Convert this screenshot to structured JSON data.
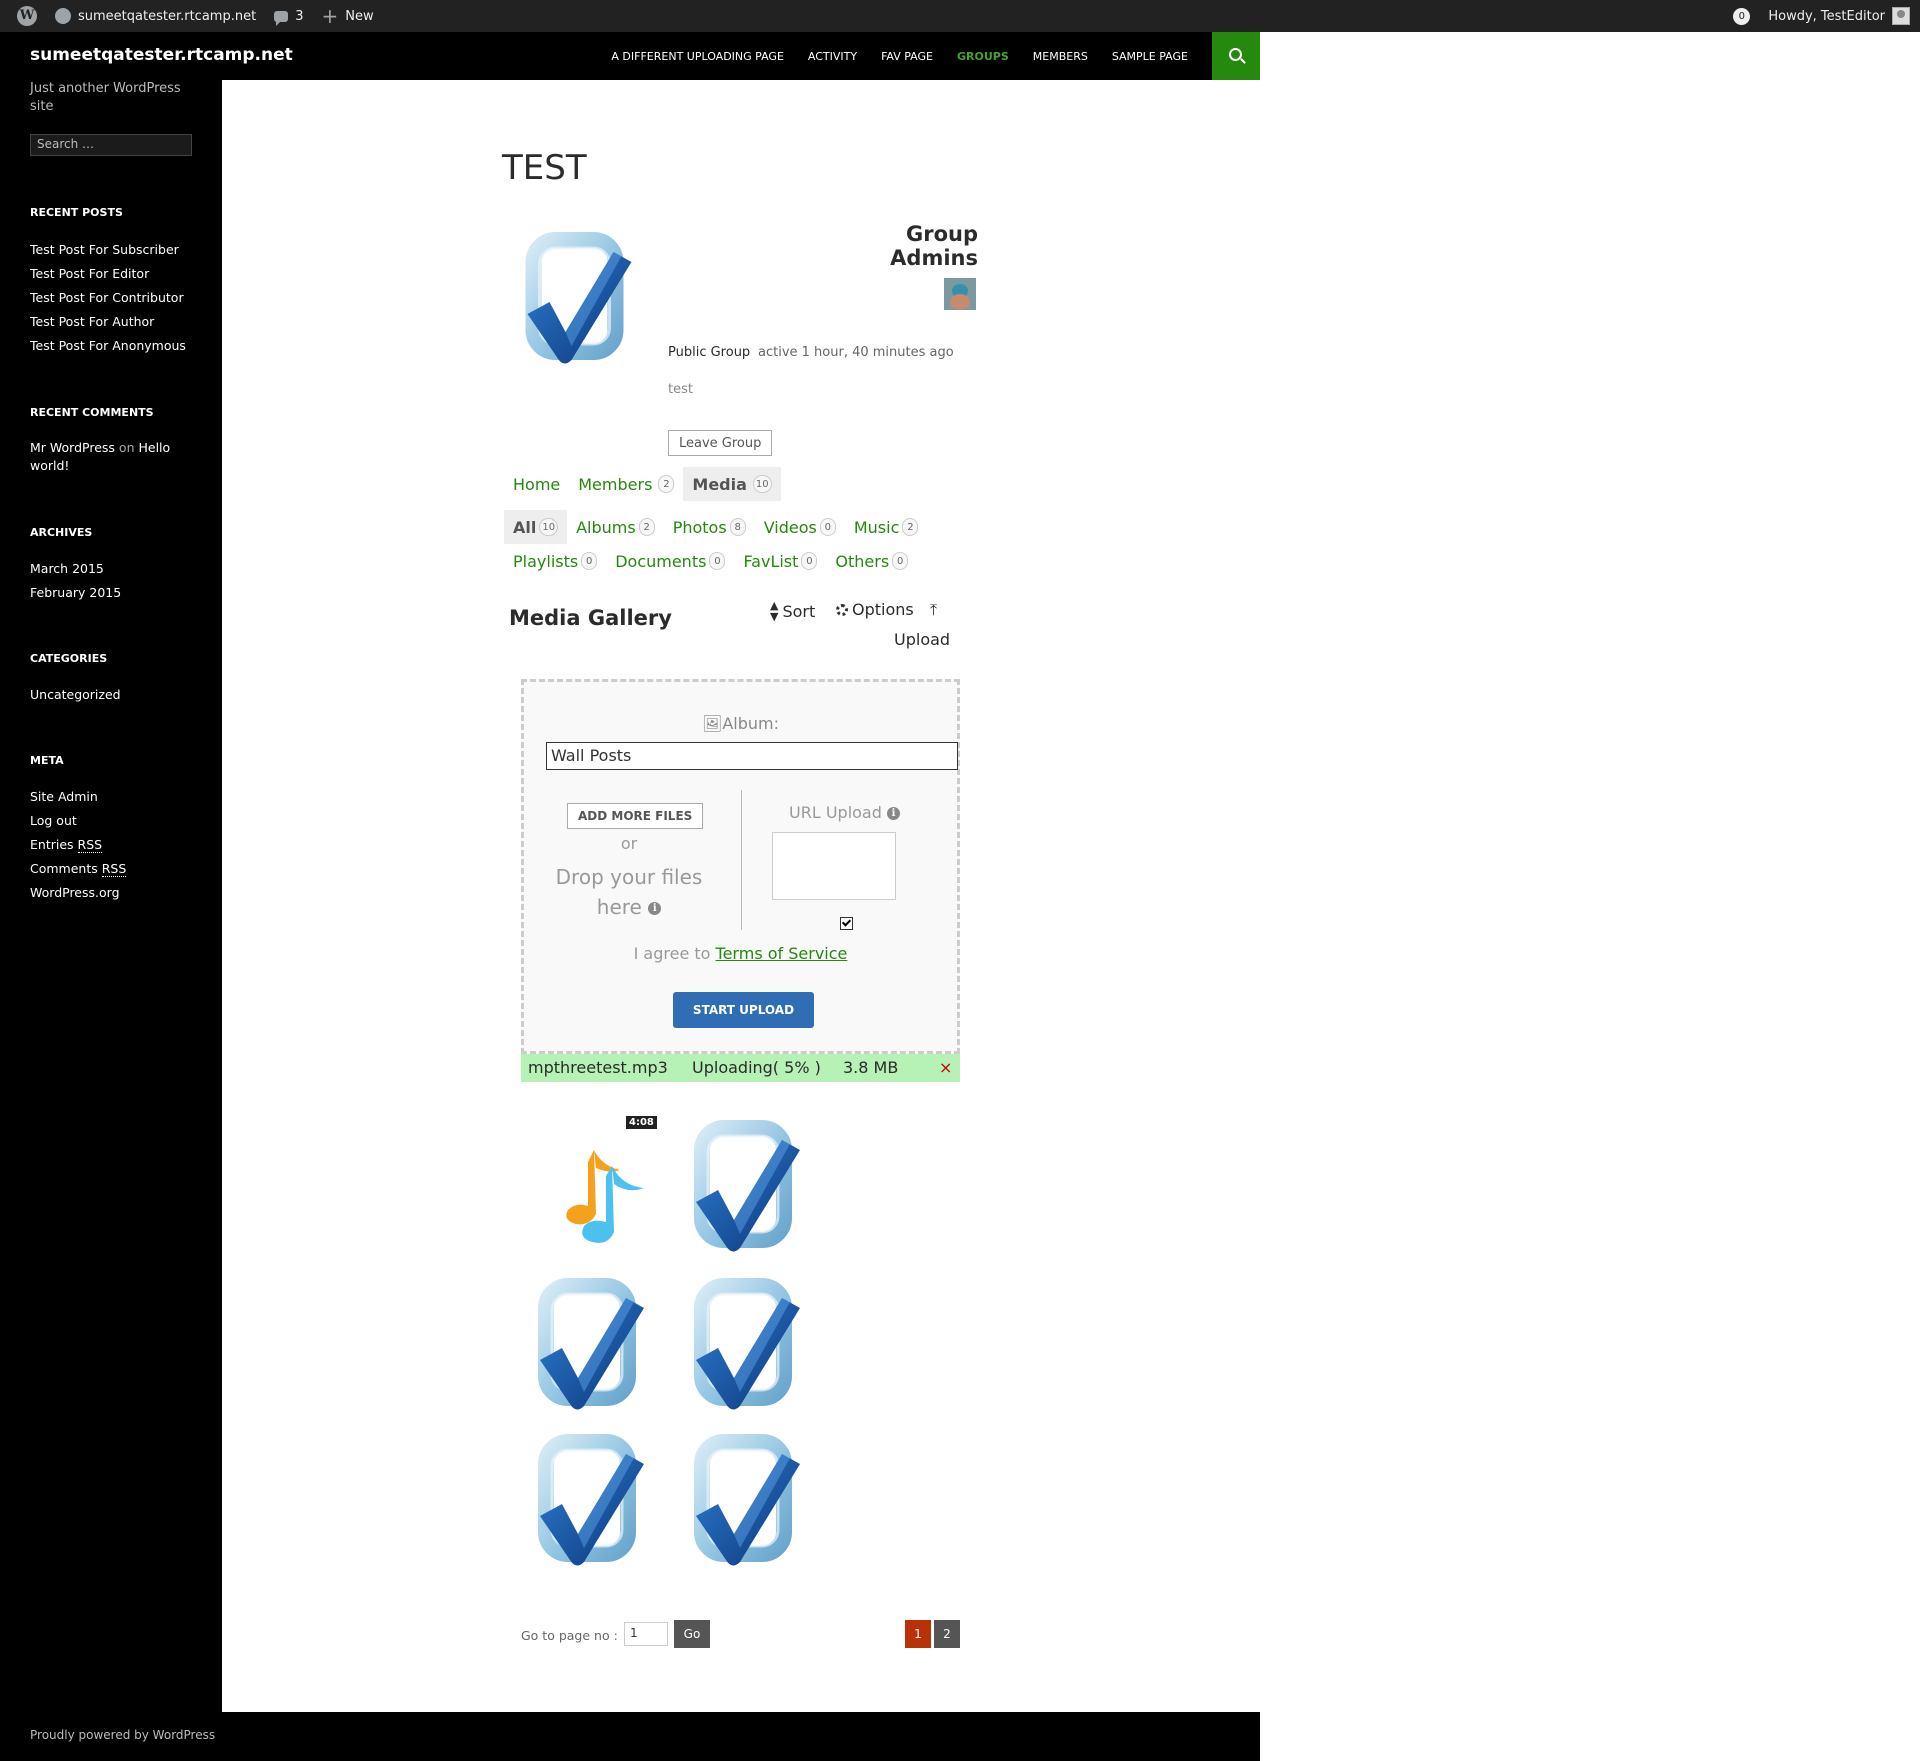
{
  "adminbar": {
    "site": "sumeetqatester.rtcamp.net",
    "comments_count": "3",
    "new_label": "New",
    "notifications": "0",
    "howdy": "Howdy, TestEditor"
  },
  "header": {
    "site_title": "sumeetqatester.rtcamp.net",
    "nav": [
      "A DIFFERENT UPLOADING PAGE",
      "ACTIVITY",
      "FAV PAGE",
      "GROUPS",
      "MEMBERS",
      "SAMPLE PAGE"
    ],
    "active_nav": "GROUPS"
  },
  "sidebar": {
    "tagline": "Just another WordPress site",
    "search_placeholder": "Search …",
    "recent_posts_title": "RECENT POSTS",
    "recent_posts": [
      "Test Post For Subscriber",
      "Test Post For Editor",
      "Test Post For Contributor",
      "Test Post For Author",
      "Test Post For Anonymous"
    ],
    "recent_comments_title": "RECENT COMMENTS",
    "recent_comment": {
      "author": "Mr WordPress",
      "on": "on",
      "post": "Hello world!"
    },
    "archives_title": "ARCHIVES",
    "archives": [
      "March 2015",
      "February 2015"
    ],
    "categories_title": "CATEGORIES",
    "categories": [
      "Uncategorized"
    ],
    "meta_title": "META",
    "meta": [
      {
        "text": "Site Admin"
      },
      {
        "text": "Log out"
      },
      {
        "text": "Entries ",
        "suffix": "RSS"
      },
      {
        "text": "Comments ",
        "suffix": "RSS"
      },
      {
        "text": "WordPress.org"
      }
    ]
  },
  "footer": {
    "text": "Proudly powered by WordPress"
  },
  "group": {
    "title": "TEST",
    "admins_title": "Group Admins",
    "type": "Public Group",
    "activity": "active 1 hour, 40 minutes ago",
    "description": "test",
    "leave_button": "Leave Group"
  },
  "group_nav": [
    {
      "label": "Home",
      "count": null,
      "current": false
    },
    {
      "label": "Members",
      "count": "2",
      "current": false
    },
    {
      "label": "Media",
      "count": "10",
      "current": true
    }
  ],
  "media_tabs": [
    {
      "label": "All",
      "count": "10",
      "current": true
    },
    {
      "label": "Albums",
      "count": "2",
      "current": false
    },
    {
      "label": "Photos",
      "count": "8",
      "current": false
    },
    {
      "label": "Videos",
      "count": "0",
      "current": false
    },
    {
      "label": "Music",
      "count": "2",
      "current": false
    },
    {
      "label": "Playlists",
      "count": "0",
      "current": false
    },
    {
      "label": "Documents",
      "count": "0",
      "current": false
    },
    {
      "label": "FavList",
      "count": "0",
      "current": false
    },
    {
      "label": "Others",
      "count": "0",
      "current": false
    }
  ],
  "gallery": {
    "title": "Media Gallery",
    "sort_label": "Sort",
    "options_label": "Options",
    "upload_label": "Upload"
  },
  "uploader": {
    "album_label": "Album:",
    "album_value": "Wall Posts",
    "add_files": "ADD MORE FILES",
    "or": "or",
    "drop_text": "Drop your files here",
    "url_upload_label": "URL Upload",
    "agree_prefix": "I agree to",
    "terms_link": "Terms of Service",
    "start_upload": "START UPLOAD",
    "terms_checked": true
  },
  "queue": {
    "file_name": "mpthreetest.mp3",
    "status": "Uploading( 5% )",
    "size": "3.8 MB",
    "remove": "×",
    "progress_percent": 5
  },
  "thumbnails": [
    {
      "kind": "music",
      "duration": "4:08"
    },
    {
      "kind": "checkmark"
    },
    {
      "kind": "checkmark"
    },
    {
      "kind": "checkmark"
    },
    {
      "kind": "checkmark"
    },
    {
      "kind": "checkmark"
    }
  ],
  "pagination": {
    "goto_label": "Go to page no :",
    "goto_value": "1",
    "go_button": "Go",
    "pages": [
      "1",
      "2"
    ],
    "current_page": "1"
  },
  "colors": {
    "accent": "#24890d",
    "active_nav": "#41a62a",
    "start_upload": "#2f6eb5",
    "current_page": "#b93207",
    "queue_bg": "#b6f1b6"
  }
}
